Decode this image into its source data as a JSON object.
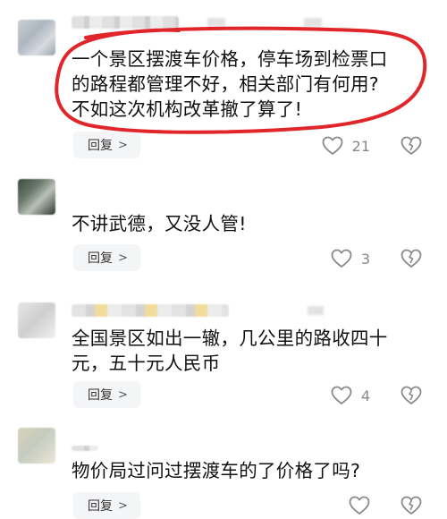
{
  "comments": [
    {
      "text": "一个景区摆渡车价格，停车场到检票口\n的路程都管理不好，相关部门有何用?\n不如这次机构改革撤了算了!",
      "reply_label": "回复",
      "likes": "21"
    },
    {
      "text": "不讲武德，又没人管!",
      "reply_label": "回复",
      "likes": "3"
    },
    {
      "text": "全国景区如出一辙，几公里的路收四十\n元，五十元人民币",
      "reply_label": "回复",
      "likes": "4"
    },
    {
      "text": "物价局过问过摆渡车的了价格了吗?",
      "reply_label": "回复",
      "likes": ""
    }
  ],
  "icons": {
    "like": "heart-outline-icon",
    "dislike": "broken-heart-icon",
    "chevron": "chevron-right-icon"
  },
  "colors": {
    "highlight_circle": "#e0262a",
    "icon_gray": "#8a8a8a",
    "reply_bg": "#f4f5f7"
  }
}
